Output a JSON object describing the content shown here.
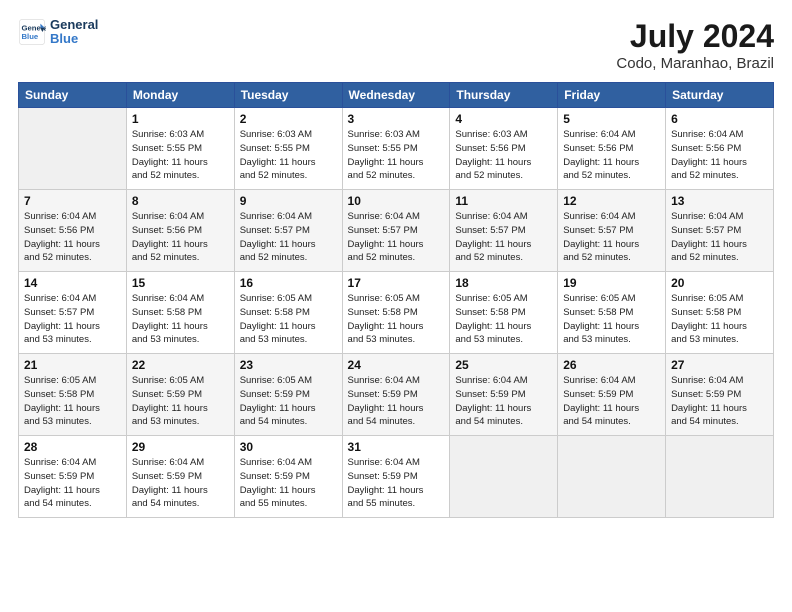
{
  "header": {
    "logo_line1": "General",
    "logo_line2": "Blue",
    "month_year": "July 2024",
    "location": "Codo, Maranhao, Brazil"
  },
  "calendar": {
    "days_of_week": [
      "Sunday",
      "Monday",
      "Tuesday",
      "Wednesday",
      "Thursday",
      "Friday",
      "Saturday"
    ],
    "weeks": [
      [
        {
          "day": "",
          "info": ""
        },
        {
          "day": "1",
          "info": "Sunrise: 6:03 AM\nSunset: 5:55 PM\nDaylight: 11 hours\nand 52 minutes."
        },
        {
          "day": "2",
          "info": "Sunrise: 6:03 AM\nSunset: 5:55 PM\nDaylight: 11 hours\nand 52 minutes."
        },
        {
          "day": "3",
          "info": "Sunrise: 6:03 AM\nSunset: 5:55 PM\nDaylight: 11 hours\nand 52 minutes."
        },
        {
          "day": "4",
          "info": "Sunrise: 6:03 AM\nSunset: 5:56 PM\nDaylight: 11 hours\nand 52 minutes."
        },
        {
          "day": "5",
          "info": "Sunrise: 6:04 AM\nSunset: 5:56 PM\nDaylight: 11 hours\nand 52 minutes."
        },
        {
          "day": "6",
          "info": "Sunrise: 6:04 AM\nSunset: 5:56 PM\nDaylight: 11 hours\nand 52 minutes."
        }
      ],
      [
        {
          "day": "7",
          "info": "Sunrise: 6:04 AM\nSunset: 5:56 PM\nDaylight: 11 hours\nand 52 minutes."
        },
        {
          "day": "8",
          "info": "Sunrise: 6:04 AM\nSunset: 5:56 PM\nDaylight: 11 hours\nand 52 minutes."
        },
        {
          "day": "9",
          "info": "Sunrise: 6:04 AM\nSunset: 5:57 PM\nDaylight: 11 hours\nand 52 minutes."
        },
        {
          "day": "10",
          "info": "Sunrise: 6:04 AM\nSunset: 5:57 PM\nDaylight: 11 hours\nand 52 minutes."
        },
        {
          "day": "11",
          "info": "Sunrise: 6:04 AM\nSunset: 5:57 PM\nDaylight: 11 hours\nand 52 minutes."
        },
        {
          "day": "12",
          "info": "Sunrise: 6:04 AM\nSunset: 5:57 PM\nDaylight: 11 hours\nand 52 minutes."
        },
        {
          "day": "13",
          "info": "Sunrise: 6:04 AM\nSunset: 5:57 PM\nDaylight: 11 hours\nand 52 minutes."
        }
      ],
      [
        {
          "day": "14",
          "info": "Sunrise: 6:04 AM\nSunset: 5:57 PM\nDaylight: 11 hours\nand 53 minutes."
        },
        {
          "day": "15",
          "info": "Sunrise: 6:04 AM\nSunset: 5:58 PM\nDaylight: 11 hours\nand 53 minutes."
        },
        {
          "day": "16",
          "info": "Sunrise: 6:05 AM\nSunset: 5:58 PM\nDaylight: 11 hours\nand 53 minutes."
        },
        {
          "day": "17",
          "info": "Sunrise: 6:05 AM\nSunset: 5:58 PM\nDaylight: 11 hours\nand 53 minutes."
        },
        {
          "day": "18",
          "info": "Sunrise: 6:05 AM\nSunset: 5:58 PM\nDaylight: 11 hours\nand 53 minutes."
        },
        {
          "day": "19",
          "info": "Sunrise: 6:05 AM\nSunset: 5:58 PM\nDaylight: 11 hours\nand 53 minutes."
        },
        {
          "day": "20",
          "info": "Sunrise: 6:05 AM\nSunset: 5:58 PM\nDaylight: 11 hours\nand 53 minutes."
        }
      ],
      [
        {
          "day": "21",
          "info": "Sunrise: 6:05 AM\nSunset: 5:58 PM\nDaylight: 11 hours\nand 53 minutes."
        },
        {
          "day": "22",
          "info": "Sunrise: 6:05 AM\nSunset: 5:59 PM\nDaylight: 11 hours\nand 53 minutes."
        },
        {
          "day": "23",
          "info": "Sunrise: 6:05 AM\nSunset: 5:59 PM\nDaylight: 11 hours\nand 54 minutes."
        },
        {
          "day": "24",
          "info": "Sunrise: 6:04 AM\nSunset: 5:59 PM\nDaylight: 11 hours\nand 54 minutes."
        },
        {
          "day": "25",
          "info": "Sunrise: 6:04 AM\nSunset: 5:59 PM\nDaylight: 11 hours\nand 54 minutes."
        },
        {
          "day": "26",
          "info": "Sunrise: 6:04 AM\nSunset: 5:59 PM\nDaylight: 11 hours\nand 54 minutes."
        },
        {
          "day": "27",
          "info": "Sunrise: 6:04 AM\nSunset: 5:59 PM\nDaylight: 11 hours\nand 54 minutes."
        }
      ],
      [
        {
          "day": "28",
          "info": "Sunrise: 6:04 AM\nSunset: 5:59 PM\nDaylight: 11 hours\nand 54 minutes."
        },
        {
          "day": "29",
          "info": "Sunrise: 6:04 AM\nSunset: 5:59 PM\nDaylight: 11 hours\nand 54 minutes."
        },
        {
          "day": "30",
          "info": "Sunrise: 6:04 AM\nSunset: 5:59 PM\nDaylight: 11 hours\nand 55 minutes."
        },
        {
          "day": "31",
          "info": "Sunrise: 6:04 AM\nSunset: 5:59 PM\nDaylight: 11 hours\nand 55 minutes."
        },
        {
          "day": "",
          "info": ""
        },
        {
          "day": "",
          "info": ""
        },
        {
          "day": "",
          "info": ""
        }
      ]
    ]
  }
}
